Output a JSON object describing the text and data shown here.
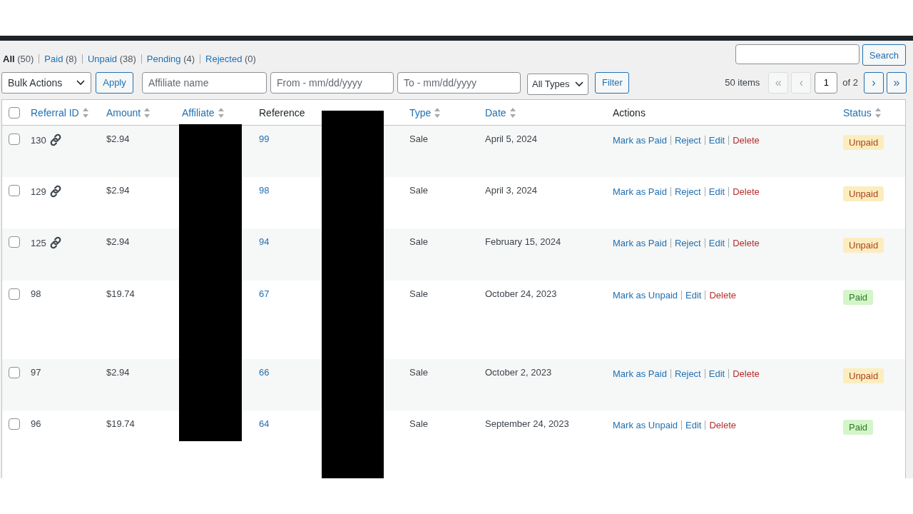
{
  "views": [
    {
      "label": "All",
      "count": "(50)",
      "selected": true
    },
    {
      "label": "Paid",
      "count": "(8)",
      "selected": false
    },
    {
      "label": "Unpaid",
      "count": "(38)",
      "selected": false
    },
    {
      "label": "Pending",
      "count": "(4)",
      "selected": false
    },
    {
      "label": "Rejected",
      "count": "(0)",
      "selected": false
    }
  ],
  "search": {
    "button": "Search"
  },
  "filters": {
    "bulk_actions": "Bulk Actions",
    "apply": "Apply",
    "affiliate_placeholder": "Affiliate name",
    "from_placeholder": "From - mm/dd/yyyy",
    "to_placeholder": "To - mm/dd/yyyy",
    "type_select": "All Types",
    "filter": "Filter"
  },
  "pagination": {
    "items": "50 items",
    "first": "«",
    "prev": "‹",
    "page": "1",
    "of": "of 2",
    "next": "›",
    "last": "»"
  },
  "table": {
    "select_all_checked": false,
    "columns": [
      {
        "label": "Referral ID",
        "sortable": true
      },
      {
        "label": "Amount",
        "sortable": true
      },
      {
        "label": "Affiliate",
        "sortable": true
      },
      {
        "label": "Reference",
        "sortable": false
      },
      {
        "label": "Type",
        "sortable": true
      },
      {
        "label": "Date",
        "sortable": true
      },
      {
        "label": "Actions",
        "sortable": false
      },
      {
        "label": "Status",
        "sortable": true
      }
    ],
    "rows": [
      {
        "checked": false,
        "id": "130",
        "link_icon": true,
        "amount": "$2.94",
        "reference": "99",
        "type": "Sale",
        "date": "April 5, 2024",
        "actions": [
          {
            "label": "Mark as Paid",
            "kind": "link"
          },
          {
            "label": "Reject",
            "kind": "link"
          },
          {
            "label": "Edit",
            "kind": "link"
          },
          {
            "label": "Delete",
            "kind": "danger"
          }
        ],
        "status": {
          "label": "Unpaid",
          "kind": "unpaid"
        }
      },
      {
        "checked": false,
        "id": "129",
        "link_icon": true,
        "amount": "$2.94",
        "reference": "98",
        "type": "Sale",
        "date": "April 3, 2024",
        "actions": [
          {
            "label": "Mark as Paid",
            "kind": "link"
          },
          {
            "label": "Reject",
            "kind": "link"
          },
          {
            "label": "Edit",
            "kind": "link"
          },
          {
            "label": "Delete",
            "kind": "danger"
          }
        ],
        "status": {
          "label": "Unpaid",
          "kind": "unpaid"
        }
      },
      {
        "checked": false,
        "id": "125",
        "link_icon": true,
        "amount": "$2.94",
        "reference": "94",
        "type": "Sale",
        "date": "February 15, 2024",
        "actions": [
          {
            "label": "Mark as Paid",
            "kind": "link"
          },
          {
            "label": "Reject",
            "kind": "link"
          },
          {
            "label": "Edit",
            "kind": "link"
          },
          {
            "label": "Delete",
            "kind": "danger"
          }
        ],
        "status": {
          "label": "Unpaid",
          "kind": "unpaid"
        }
      },
      {
        "checked": false,
        "id": "98",
        "link_icon": false,
        "amount": "$19.74",
        "reference": "67",
        "type": "Sale",
        "date": "October 24, 2023",
        "actions": [
          {
            "label": "Mark as Unpaid",
            "kind": "link"
          },
          {
            "label": "Edit",
            "kind": "link"
          },
          {
            "label": "Delete",
            "kind": "danger"
          }
        ],
        "status": {
          "label": "Paid",
          "kind": "paid"
        }
      },
      {
        "checked": false,
        "id": "97",
        "link_icon": false,
        "amount": "$2.94",
        "reference": "66",
        "type": "Sale",
        "date": "October 2, 2023",
        "actions": [
          {
            "label": "Mark as Paid",
            "kind": "link"
          },
          {
            "label": "Reject",
            "kind": "link"
          },
          {
            "label": "Edit",
            "kind": "link"
          },
          {
            "label": "Delete",
            "kind": "danger"
          }
        ],
        "status": {
          "label": "Unpaid",
          "kind": "unpaid"
        }
      },
      {
        "checked": false,
        "id": "96",
        "link_icon": false,
        "amount": "$19.74",
        "reference": "64",
        "type": "Sale",
        "date": "September 24, 2023",
        "actions": [
          {
            "label": "Mark as Unpaid",
            "kind": "link"
          },
          {
            "label": "Edit",
            "kind": "link"
          },
          {
            "label": "Delete",
            "kind": "danger"
          }
        ],
        "status": {
          "label": "Paid",
          "kind": "paid"
        }
      }
    ]
  }
}
